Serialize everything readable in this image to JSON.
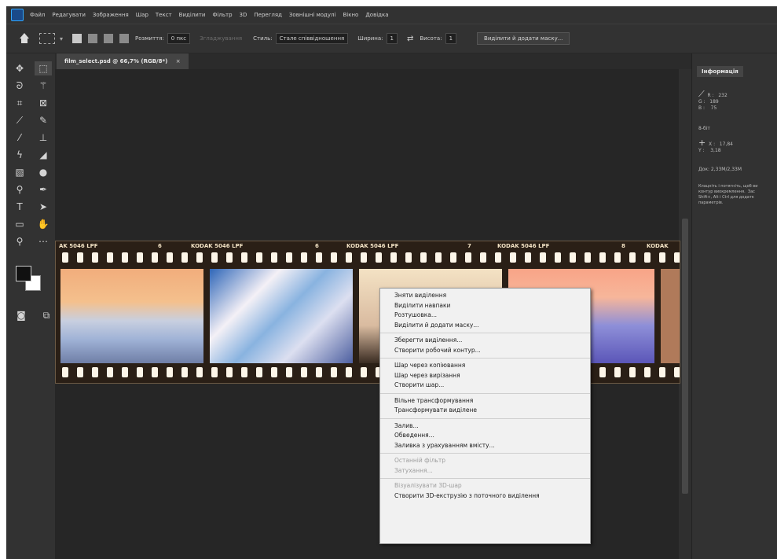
{
  "menubar": {
    "items": [
      "Файл",
      "Редагувати",
      "Зображення",
      "Шар",
      "Текст",
      "Виділити",
      "Фільтр",
      "3D",
      "Перегляд",
      "Зовнішні модулі",
      "Вікно",
      "Довідка"
    ]
  },
  "options": {
    "feather_label": "Розмиття:",
    "feather_value": "0 пкс",
    "antialias_label": "Згладжування",
    "style_label": "Стиль:",
    "style_value": "Стале співвідношення",
    "width_label": "Ширина:",
    "width_value": "1",
    "height_label": "Висота:",
    "height_value": "1",
    "select_mask_button": "Виділити й додати маску..."
  },
  "document": {
    "tab_title": "film_select.psd @ 66,7% (RGB/8*)",
    "film_labels": [
      "AK 5046 LPF",
      "6",
      "KODAK 5046 LPF",
      "6",
      "KODAK 5046 LPF",
      "7",
      "KODAK 5046 LPF",
      "8",
      "KODAK"
    ]
  },
  "info_panel": {
    "tab": "Інформація",
    "rgb_text": "R :   232\nG :   189\nB :    75",
    "depth": "8-біт",
    "xy_text": "X :   17,84\nY :    3,18",
    "doc_size": "Док: 2,33M/2,33M",
    "hint": "Клацніть і потягніть, щоб ви\nконтур виокремлення.  Зас\nShift+, Alt і Ctrl для додатк\nпараметрів."
  },
  "context_menu": {
    "groups": [
      [
        {
          "label": "Зняти виділення",
          "enabled": true
        },
        {
          "label": "Виділити навпаки",
          "enabled": true
        },
        {
          "label": "Розтушовка...",
          "enabled": true
        },
        {
          "label": "Виділити й додати маску...",
          "enabled": true
        }
      ],
      [
        {
          "label": "Зберегти виділення...",
          "enabled": true
        },
        {
          "label": "Створити робочий контур...",
          "enabled": true
        }
      ],
      [
        {
          "label": "Шар через копіювання",
          "enabled": true
        },
        {
          "label": "Шар через вирізання",
          "enabled": true
        },
        {
          "label": "Створити шар...",
          "enabled": true
        }
      ],
      [
        {
          "label": "Вільне трансформування",
          "enabled": true
        },
        {
          "label": "Трансформувати виділене",
          "enabled": true
        }
      ],
      [
        {
          "label": "Залив...",
          "enabled": true
        },
        {
          "label": "Обведення...",
          "enabled": true
        },
        {
          "label": "Заливка з урахуванням вмісту...",
          "enabled": true
        }
      ],
      [
        {
          "label": "Останній фільтр",
          "enabled": false
        },
        {
          "label": "Затухання...",
          "enabled": false
        }
      ],
      [
        {
          "label": "Візуалізувати 3D-шар",
          "enabled": false
        },
        {
          "label": "Створити 3D-екструзію з поточного виділення",
          "enabled": true
        }
      ]
    ]
  },
  "colors": {
    "accent": "#31a8ff",
    "foreground": "#111111",
    "background": "#ffffff"
  }
}
